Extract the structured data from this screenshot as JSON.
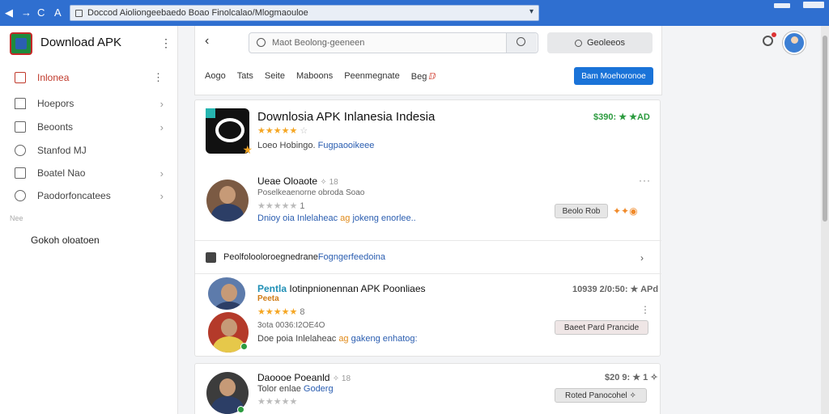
{
  "browser": {
    "url": "Doccod Aioliongeebaedo Boao Finolcalao/Mlogmaouloe",
    "nav_back": "◀",
    "nav_forward": "→",
    "nav_reload": "C",
    "nav_home": "A"
  },
  "sidebar": {
    "app_title": "Download APK",
    "items": [
      {
        "label": "Inlonea",
        "active": true,
        "icon": "square-icon"
      },
      {
        "label": "Hoepors",
        "icon": "home-icon"
      },
      {
        "label": "Beoonts",
        "icon": "square-icon"
      },
      {
        "label": "Stanfod MJ",
        "icon": "clock-icon"
      },
      {
        "label": "Boatel Nao",
        "icon": "gallery-icon"
      },
      {
        "label": "Paodorfoncatees",
        "icon": "tag-icon"
      }
    ],
    "section_label": "Nee",
    "footer_label": "Gokoh oloatoen"
  },
  "header": {
    "search_placeholder": "Maot Beolong-geeneen",
    "top_button": "Geoleeos",
    "tabs": [
      "Aogo",
      "Tats",
      "Seite",
      "Maboons",
      "Peenmegnate",
      "Beg"
    ],
    "primary_button": "Bam Moehoronoe"
  },
  "featured": {
    "title": "Downlosia APK Inlanesia Indesia",
    "rating_stars": "★★★★★",
    "rating_text": "☆",
    "price": "$390: ★ ★AD",
    "meta_prefix": "Loeo Hobingo.",
    "meta_link": "Fugpaooikeee"
  },
  "review1": {
    "name": "Ueae Oloaote",
    "name_suffix": "✧ 18",
    "link": "Poselkeaenorne obroda Soao",
    "rating_text": "1",
    "meta": "Dnioy oia Inlelaheac",
    "meta_orange": "ag",
    "meta_link": "jokeng enorlee..",
    "button": "Beolo Rob",
    "reactions": "✦✦◉"
  },
  "section2": {
    "title": "Peolfolooloroegnedrane",
    "title_link": "Fogngerfeedoina"
  },
  "review2": {
    "name_blue": "Pentla",
    "name": "Iotinpnionennan APK Poonliaes",
    "badge": "Peeta",
    "price": "10939 2/0:50: ★ APd",
    "rating_text": "8",
    "meta": "3ota 0036:I2OE4O",
    "meta2": "Doe poia Inlelaheac",
    "meta2_orange": "ag",
    "meta2_link": "gakeng enhatog:",
    "button": "Baeet Pard Prancide"
  },
  "review3": {
    "name": "Daoooe Poeanld",
    "name_suffix": "✧ 18",
    "meta": "Tolor enlae",
    "meta_link": "Goderg",
    "price": "$20 9: ★ 1 ✧",
    "button": "Roted Panocohel ✧"
  }
}
